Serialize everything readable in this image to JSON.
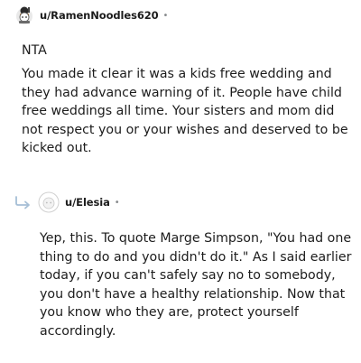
{
  "comment1": {
    "username": "u/RamenNoodles620",
    "separator": "•",
    "avatar_icon": "snoo-avatar-icon",
    "verdict": "NTA",
    "body": "You made it clear it was a kids free wedding and they had advance warning of it. People have child free weddings all time. Your sisters and mom did not respect you or your wishes and deserved to be kicked out."
  },
  "comment2": {
    "username": "u/Elesia",
    "separator": "•",
    "reply_icon": "reply-arrow-icon",
    "avatar_icon": "default-avatar-icon",
    "body": "Yep, this. To quote Marge Simpson, \"You had one thing to do and you didn't do it.\" As I said earlier today, if you can't safely say no to somebody, you don't have a healthy relationship. Now that you know who they are, protect yourself accordingly."
  },
  "colors": {
    "text": "#1c1c1c",
    "meta": "#878a8c",
    "reply_arrow": "#a6bfd6"
  }
}
